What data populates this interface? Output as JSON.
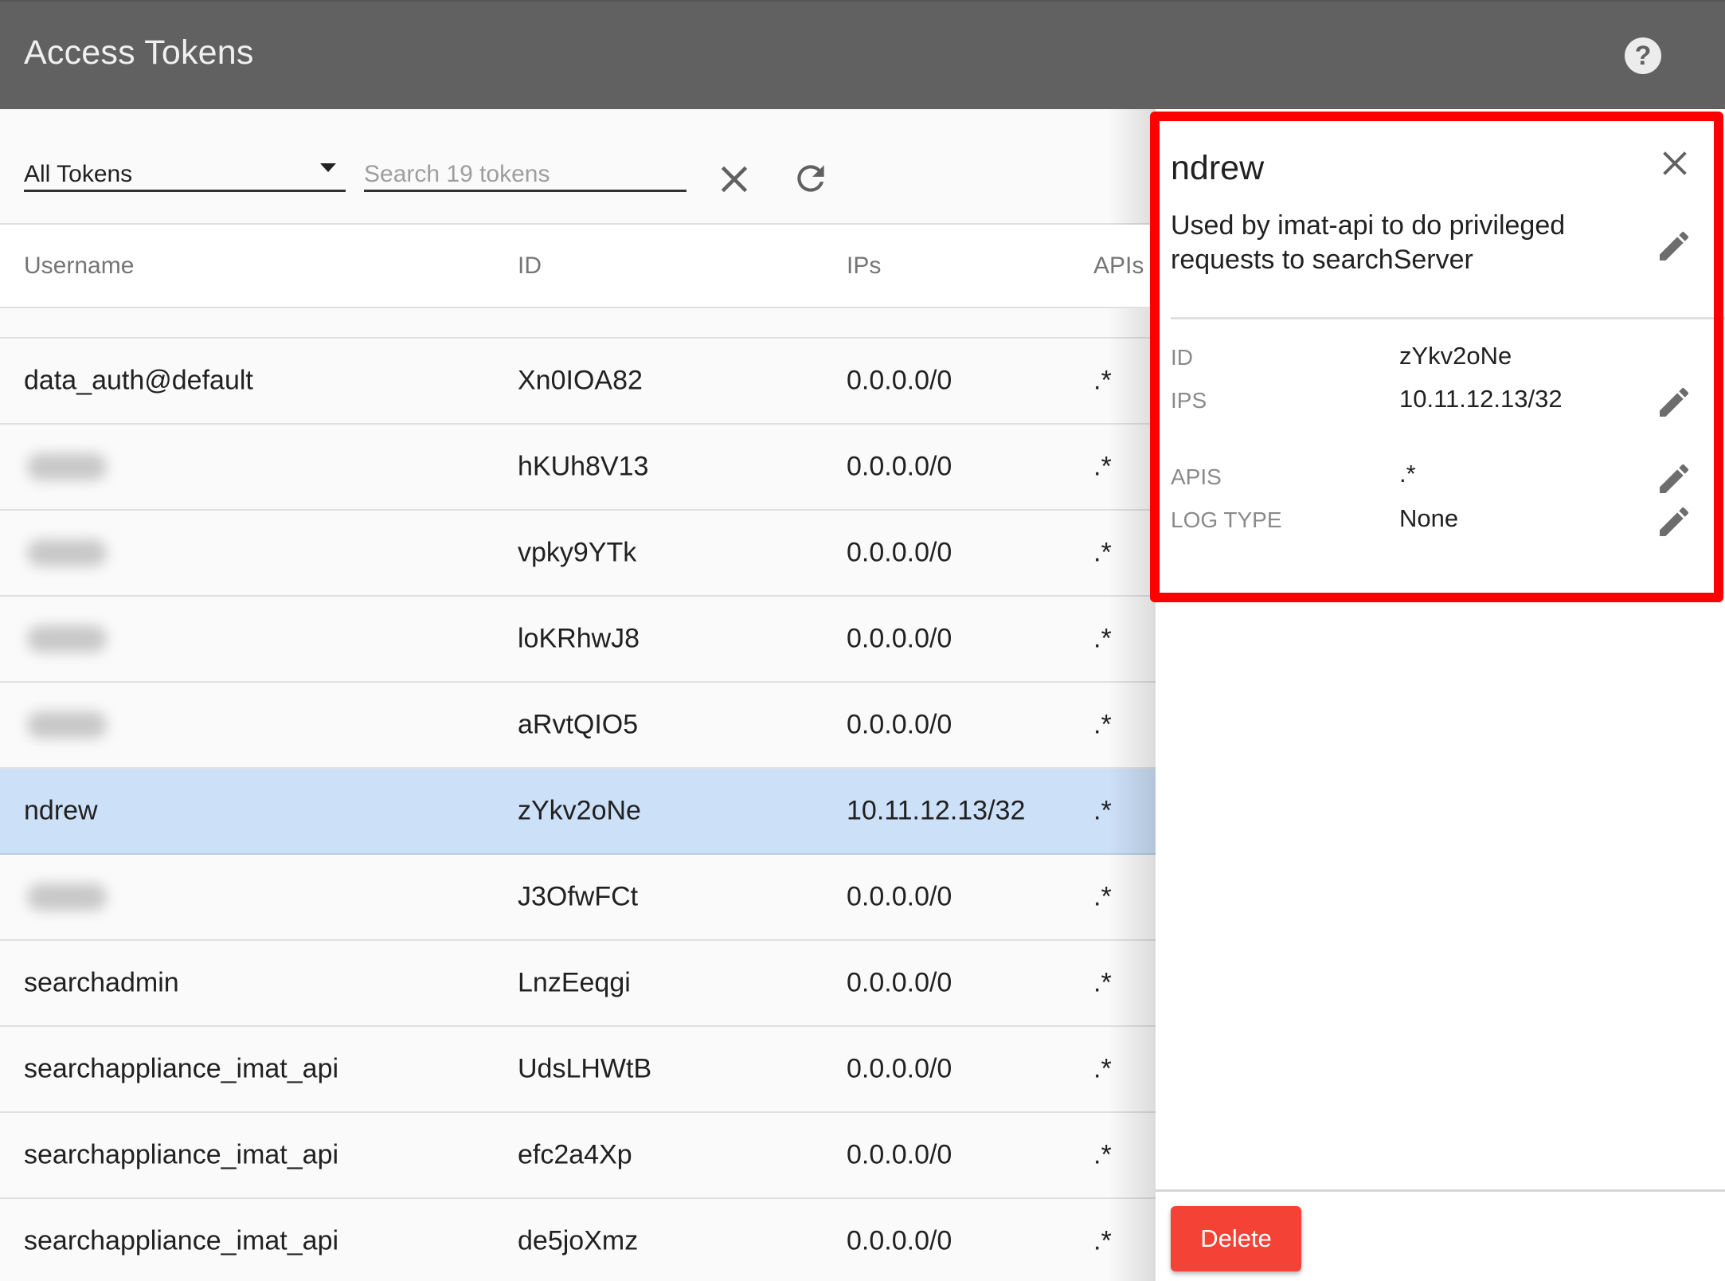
{
  "app": {
    "title": "Access Tokens",
    "help_icon": "help-circle-icon"
  },
  "toolbar": {
    "filter_value": "All Tokens",
    "search_placeholder": "Search 19 tokens",
    "search_value": "",
    "clear_icon": "close-icon",
    "refresh_icon": "refresh-icon"
  },
  "table": {
    "columns": [
      "Username",
      "ID",
      "IPs",
      "APIs"
    ],
    "rows": [
      {
        "username": "",
        "id": "",
        "ips": "",
        "apis": "",
        "partial": true
      },
      {
        "username": "data_auth@default",
        "id": "Xn0IOA82",
        "ips": "0.0.0.0/0",
        "apis": ".*"
      },
      {
        "username": "",
        "redacted": true,
        "id": "hKUh8V13",
        "ips": "0.0.0.0/0",
        "apis": ".*"
      },
      {
        "username": "",
        "redacted": true,
        "id": "vpky9YTk",
        "ips": "0.0.0.0/0",
        "apis": ".*"
      },
      {
        "username": "",
        "redacted": true,
        "id": "loKRhwJ8",
        "ips": "0.0.0.0/0",
        "apis": ".*"
      },
      {
        "username": "",
        "redacted": true,
        "id": "aRvtQIO5",
        "ips": "0.0.0.0/0",
        "apis": ".*"
      },
      {
        "username": "ndrew",
        "id": "zYkv2oNe",
        "ips": "10.11.12.13/32",
        "apis": ".*",
        "selected": true
      },
      {
        "username": "",
        "redacted": true,
        "id": "J3OfwFCt",
        "ips": "0.0.0.0/0",
        "apis": ".*"
      },
      {
        "username": "searchadmin",
        "id": "LnzEeqgi",
        "ips": "0.0.0.0/0",
        "apis": ".*"
      },
      {
        "username": "searchappliance_imat_api",
        "id": "UdsLHWtB",
        "ips": "0.0.0.0/0",
        "apis": ".*"
      },
      {
        "username": "searchappliance_imat_api",
        "id": "efc2a4Xp",
        "ips": "0.0.0.0/0",
        "apis": ".*"
      },
      {
        "username": "searchappliance_imat_api",
        "id": "de5joXmz",
        "ips": "0.0.0.0/0",
        "apis": ".*"
      }
    ]
  },
  "detail": {
    "name": "ndrew",
    "description": "Used by imat-api to do privileged requests to searchServer",
    "properties": {
      "id": {
        "label": "ID",
        "value": "zYkv2oNe"
      },
      "ips": {
        "label": "IPS",
        "value": "10.11.12.13/32"
      },
      "apis": {
        "label": "APIS",
        "value": ".*"
      },
      "log_type": {
        "label": "LOG TYPE",
        "value": "None"
      }
    },
    "delete_label": "Delete"
  },
  "colors": {
    "app_bar": "#616161",
    "selected_row": "#cce0f8",
    "delete_button": "#f44336",
    "highlight_box": "#ff0000"
  }
}
